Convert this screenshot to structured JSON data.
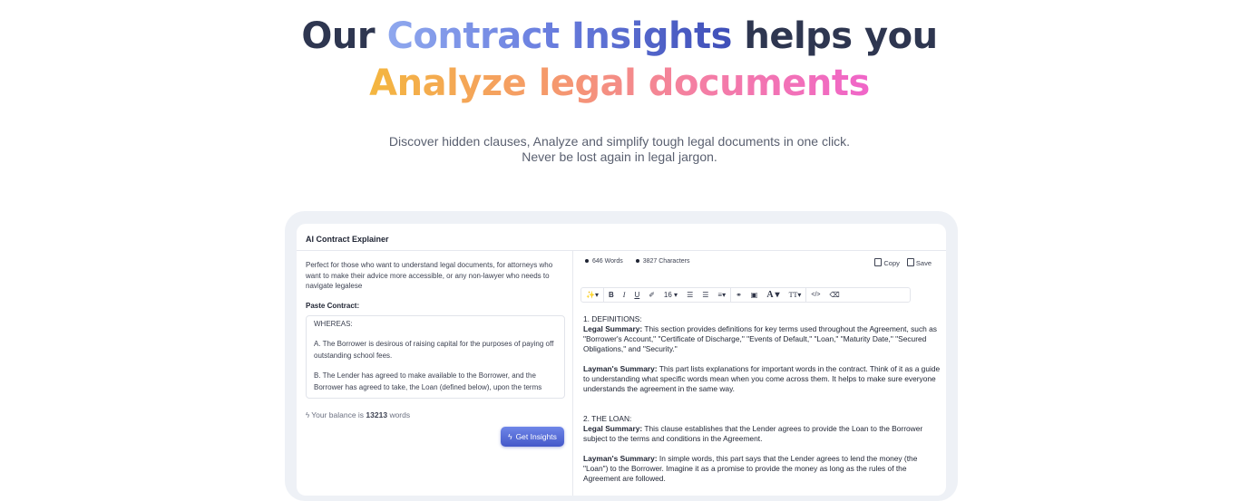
{
  "hero": {
    "line1_pre": "Our",
    "line1_highlight": "Contract Insights",
    "line1_post": "helps you",
    "line2": "Analyze legal documents"
  },
  "subtitle": {
    "line1": "Discover hidden clauses, Analyze and simplify tough legal documents in one click.",
    "line2": "Never be lost again in legal jargon."
  },
  "app": {
    "title": "AI Contract Explainer",
    "description": "Perfect for those who want to understand legal documents, for attorneys who want to make their advice more accessible, or any non-lawyer who needs to navigate legalese",
    "paste_label": "Paste Contract:",
    "contract_text": [
      "WHEREAS:",
      "A.    The Borrower is desirous of raising capital for the purposes of paying off outstanding school fees.",
      "B.    The Lender has agreed to make available to the Borrower, and the Borrower has agreed to take, the Loan (defined below), upon the terms"
    ],
    "balance_prefix": "Your balance is",
    "balance_value": "13213",
    "balance_suffix": "words",
    "get_insights_label": "Get Insights",
    "words_stat": "646 Words",
    "chars_stat": "3827 Characters",
    "copy_label": "Copy",
    "save_label": "Save",
    "toolbar": {
      "magic": "✨▾",
      "bold": "B",
      "italic": "I",
      "underline": "U",
      "eraser_style": "✐",
      "font_size": "16 ▾",
      "bullet_list": "☰",
      "numbered_list": "☰",
      "align": "≡▾",
      "link": "⚭",
      "image": "▣",
      "font_color": "A ▾",
      "text_style": "TT▾",
      "code": "</>",
      "clear": "⌫"
    },
    "output": {
      "s1_heading": "1. DEFINITIONS:",
      "s1_legal_label": "Legal Summary:",
      "s1_legal_text": " This section provides definitions for key terms used throughout the Agreement, such as \"Borrower's Account,\" \"Certificate of Discharge,\" \"Events of Default,\" \"Loan,\" \"Maturity Date,\" \"Secured Obligations,\" and \"Security.\"",
      "s1_layman_label": "Layman's Summary:",
      "s1_layman_text": " This part lists explanations for important words in the contract. Think of it as a guide to understanding what specific words mean when you come across them. It helps to make sure everyone understands the agreement in the same way.",
      "s2_heading": "2. THE LOAN:",
      "s2_legal_label": "Legal Summary:",
      "s2_legal_text": " This clause establishes that the Lender agrees to provide the Loan to the Borrower subject to the terms and conditions in the Agreement.",
      "s2_layman_label": "Layman's Summary:",
      "s2_layman_text": " In simple words, this part says that the Lender agrees to lend the money (the \"Loan\") to the Borrower. Imagine it as a promise to provide the money as long as the rules of the Agreement are followed."
    }
  },
  "colors": {
    "title_dark": "#2e3650",
    "accent_blue": "#4458c9",
    "accent_orange": "#f4b63f",
    "accent_pink": "#f065c9"
  }
}
